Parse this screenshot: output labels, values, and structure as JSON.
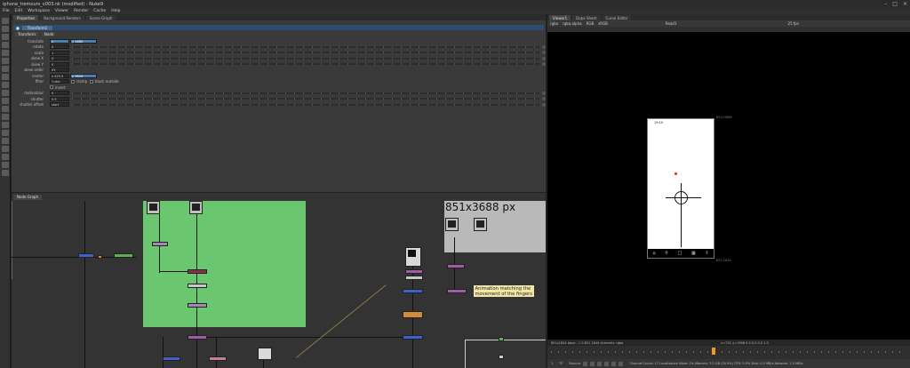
{
  "window": {
    "title": "iphone_tremours_v003.nk (modified) - Nuke9"
  },
  "menu": [
    "File",
    "Edit",
    "Workspace",
    "Viewer",
    "Render",
    "Cache",
    "Help"
  ],
  "properties": {
    "tabs": [
      "Properties",
      "Background Renders",
      "Scene Graph"
    ],
    "node_name": "Transform1",
    "subtabs": [
      "Transform",
      "Node"
    ],
    "knobs": [
      {
        "label": "translate",
        "value": "x",
        "value2": "y 1680"
      },
      {
        "label": "rotate",
        "value": "0"
      },
      {
        "label": "scale",
        "value": "1"
      },
      {
        "label": "skew X",
        "value": "0"
      },
      {
        "label": "skew Y",
        "value": "0"
      },
      {
        "label": "skew order",
        "value": "XY"
      },
      {
        "label": "center",
        "value": "x 425.5",
        "value2": "y 1844"
      },
      {
        "label": "filter",
        "value": "Cubic",
        "extra1": "clamp",
        "extra2": "black outside"
      },
      {
        "label": "",
        "value": "",
        "extra1": "invert"
      },
      {
        "label": "motionblur",
        "value": "0"
      },
      {
        "label": "shutter",
        "value": "0.5"
      },
      {
        "label": "shutter offset",
        "value": "start"
      }
    ]
  },
  "node_graph": {
    "tab": "Node Graph",
    "backdrop_label": "851x3688 px",
    "sticky_note": "Animation matching the movement of the fingers"
  },
  "viewer": {
    "tabs": [
      "Viewer1",
      "Dope Sheet",
      "Curve Editor"
    ],
    "toolbar": [
      "rgba",
      "rgba.alpha",
      "RGB",
      "sRGB",
      "Read1",
      "25 fps"
    ],
    "phone_time": "19:10",
    "bbox_label": "851x3688",
    "bbox_label2": "851,1844",
    "info_left": "851x1844 bbox: -1 0 851 1844 channels: rgba",
    "info_right": "x=751 y=1996 0.0 0.0 0.0 1.0",
    "playback": "Channel Count: 17 Localization Mode: On Memory: 3.3 GB (16.4%) CPU: 0.0% Disk: 0.0 MB/s Network: 1.0 MB/s",
    "frame": "1",
    "playrate": "TF",
    "mode": "Bounce"
  }
}
